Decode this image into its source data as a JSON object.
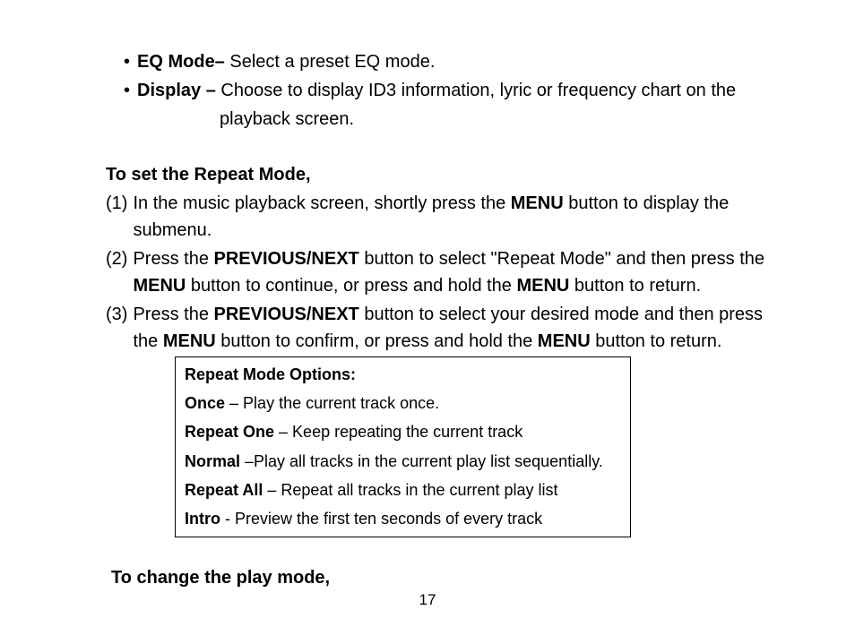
{
  "bullet_items": [
    {
      "label": "EQ Mode–",
      "text": " Select a preset EQ mode."
    },
    {
      "label": "Display –",
      "text": " Choose to display ID3 information, lyric or frequency chart on the ",
      "continuation": "playback screen."
    }
  ],
  "heading_repeat": "To set the Repeat Mode,",
  "step1_prefix": "In the music playback screen, shortly press the ",
  "step1_menu": "MENU",
  "step1_suffix": " button to display the submenu.",
  "step2_a": "Press the ",
  "step2_prevnext": "PREVIOUS/NEXT",
  "step2_b": " button to select \"Repeat Mode\" and then press the ",
  "step2_menu1": "MENU",
  "step2_c": " button to continue, or press and hold the ",
  "step2_menu2": "MENU",
  "step2_d": " button to return.",
  "step3_a": "Press the ",
  "step3_prevnext": "PREVIOUS/NEXT",
  "step3_b": " button to select your desired mode and then press the ",
  "step3_menu1": "MENU",
  "step3_c": " button to confirm, or press and hold the ",
  "step3_menu2": "MENU",
  "step3_d": " button to return.",
  "options_title": "Repeat Mode Options:",
  "options": [
    {
      "name": "Once",
      "sep": " – ",
      "desc": "Play the current track once."
    },
    {
      "name": "Repeat One",
      "sep": " – ",
      "desc": "Keep repeating the current track"
    },
    {
      "name": "Normal",
      "sep": " –",
      "desc": "Play all tracks in the current play list sequentially."
    },
    {
      "name": "Repeat All",
      "sep": " – ",
      "desc": "Repeat all tracks in the current play list"
    },
    {
      "name": "Intro",
      "sep": " - ",
      "desc": "Preview the first ten seconds of every track"
    }
  ],
  "heading_playmode": "To change the play mode,",
  "page_number": "17"
}
